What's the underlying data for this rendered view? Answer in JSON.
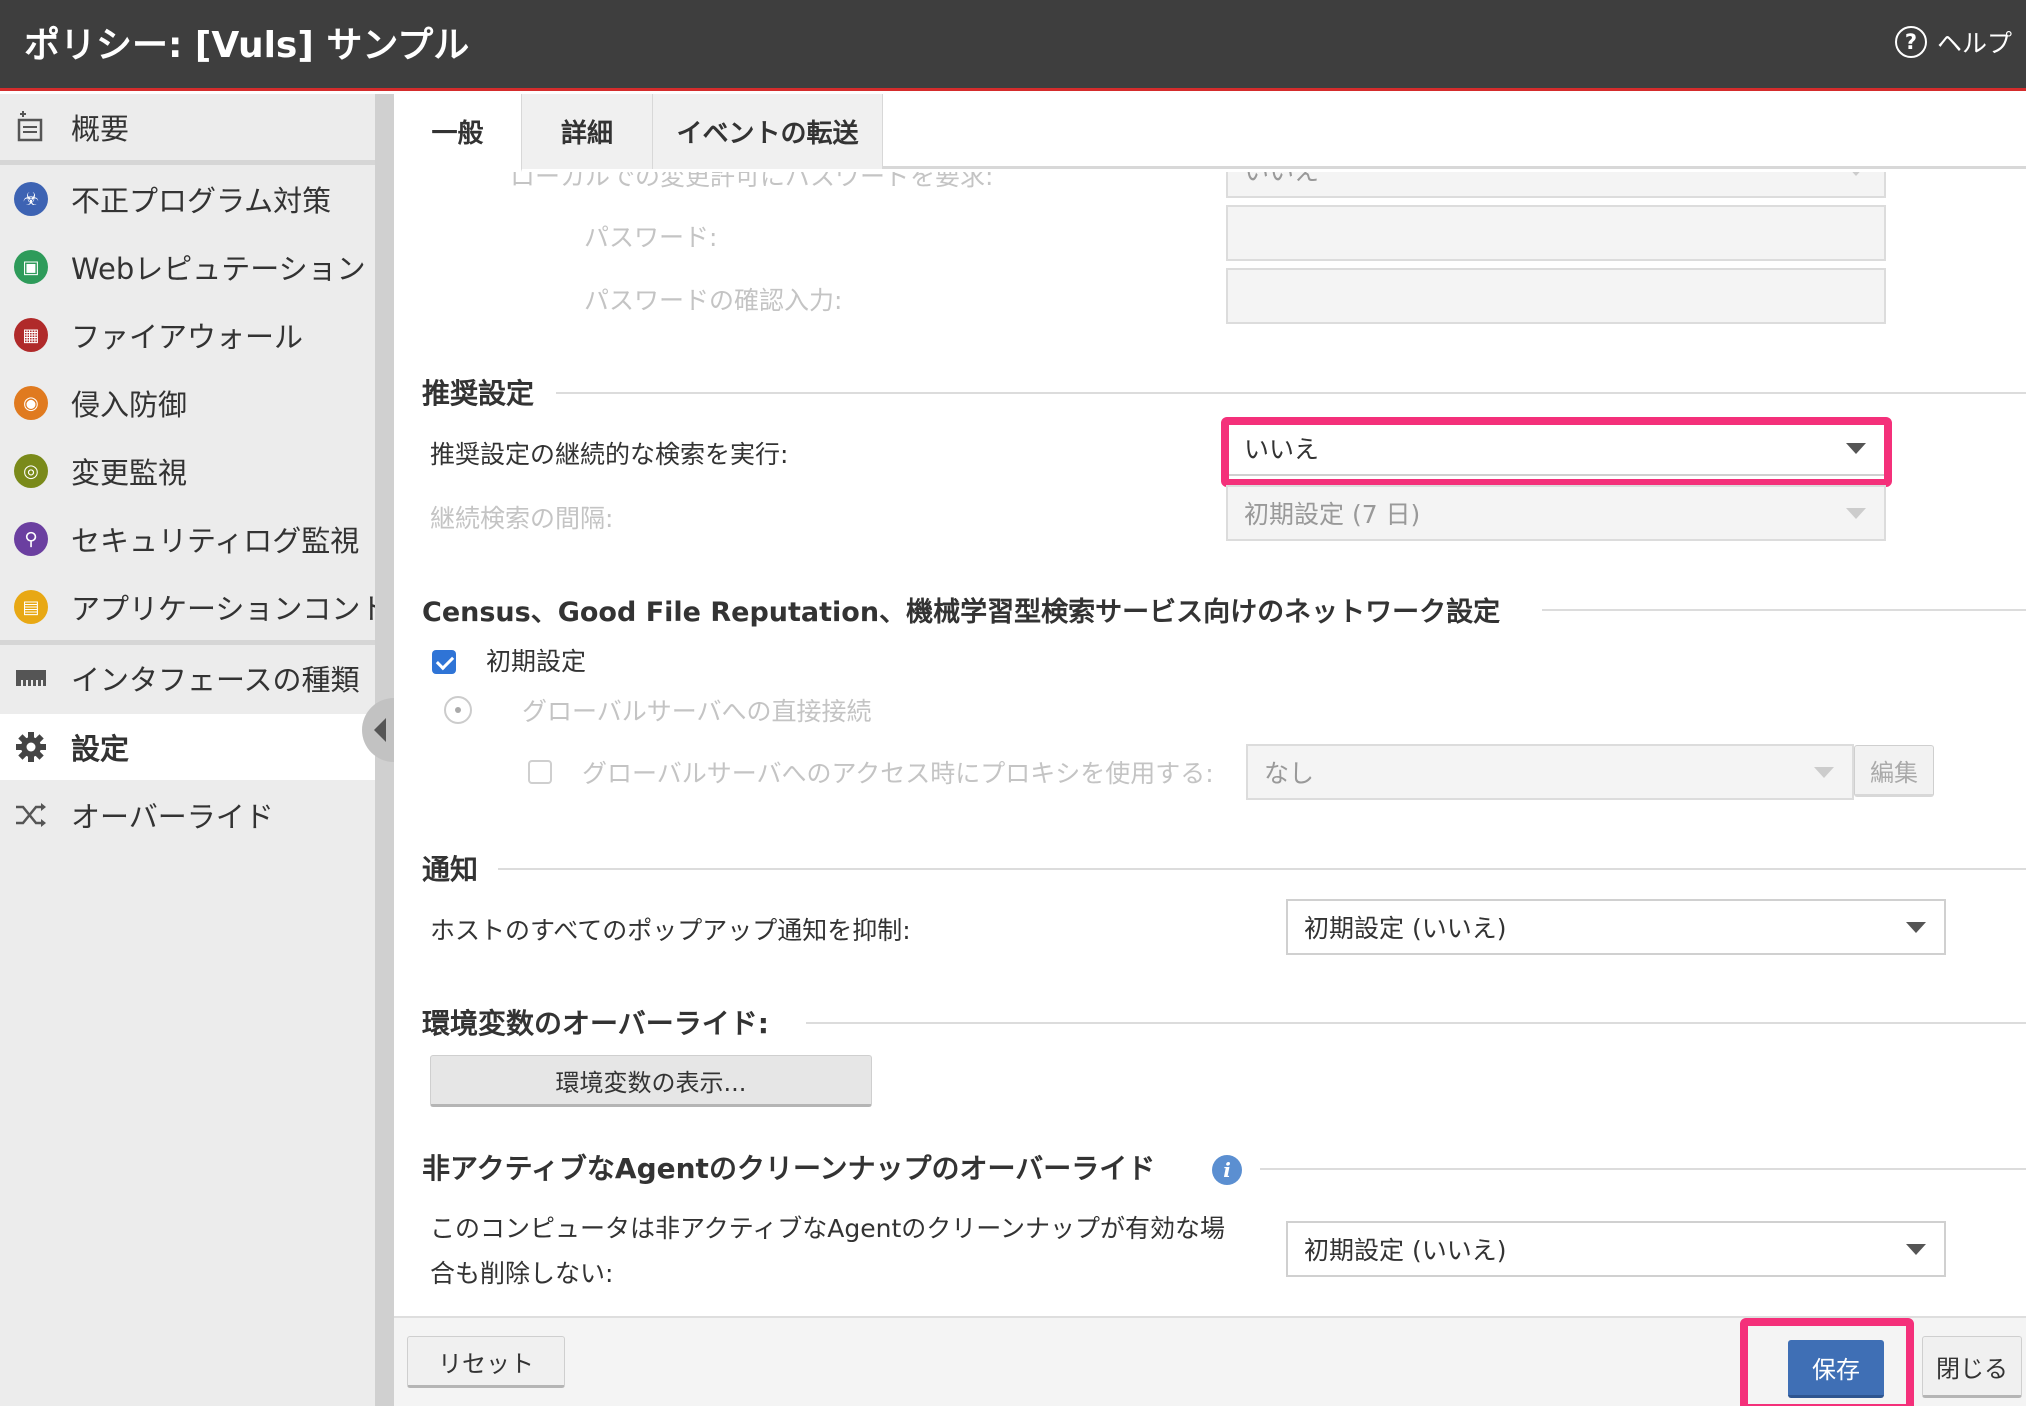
{
  "window": {
    "title": "ポリシー: [Vuls] サンプル",
    "help_label": "ヘルプ",
    "help_icon": "question-circle-icon"
  },
  "sidebar": {
    "items": [
      {
        "label": "概要",
        "icon": "overview-icon"
      },
      {
        "label": "不正プログラム対策",
        "icon": "biohazard-icon"
      },
      {
        "label": "Webレピュテーション",
        "icon": "web-reputation-icon"
      },
      {
        "label": "ファイアウォール",
        "icon": "firewall-icon"
      },
      {
        "label": "侵入防御",
        "icon": "intrusion-prevention-icon"
      },
      {
        "label": "変更監視",
        "icon": "integrity-monitoring-icon"
      },
      {
        "label": "セキュリティログ監視",
        "icon": "log-inspection-icon"
      },
      {
        "label": "アプリケーションコントロール",
        "icon": "application-control-icon"
      },
      {
        "label": "インタフェースの種類",
        "icon": "interface-icon"
      },
      {
        "label": "設定",
        "icon": "gear-icon"
      },
      {
        "label": "オーバーライド",
        "icon": "shuffle-icon"
      }
    ],
    "active": "設定"
  },
  "tabs": [
    "一般",
    "詳細",
    "イベントの転送"
  ],
  "content": {
    "top_partial": {
      "cut_label": "ローカルでの変更許可にパスワードを要求:",
      "cut_value": "いいえ",
      "password_label": "パスワード:",
      "password_confirm_label": "パスワードの確認入力:"
    },
    "recommendation": {
      "heading": "推奨設定",
      "ongoing_scan_label": "推奨設定の継続的な検索を実行:",
      "ongoing_scan_value": "いいえ",
      "interval_label": "継続検索の間隔:",
      "interval_value": "初期設定 (7 日)"
    },
    "network": {
      "heading": "Census、Good File Reputation、機械学習型検索サービス向けのネットワーク設定",
      "default_label": "初期設定",
      "default_checked": true,
      "direct_label": "グローバルサーバへの直接接続",
      "proxy_label": "グローバルサーバへのアクセス時にプロキシを使用する:",
      "proxy_value": "なし",
      "edit_label": "編集"
    },
    "notification": {
      "heading": "通知",
      "suppress_label": "ホストのすべてのポップアップ通知を抑制:",
      "suppress_value": "初期設定 (いいえ)"
    },
    "env": {
      "heading": "環境変数のオーバーライド:",
      "button_label": "環境変数の表示..."
    },
    "cleanup": {
      "heading": "非アクティブなAgentのクリーンナップのオーバーライド",
      "label_line1": "このコンピュータは非アクティブなAgentのクリーンナップが有効な場",
      "label_line2": "合も削除しない:",
      "value": "初期設定 (いいえ)"
    }
  },
  "footer": {
    "reset_label": "リセット",
    "save_label": "保存",
    "close_label": "閉じる"
  },
  "colors": {
    "titlebar": "#3e3e3e",
    "accent_line": "#d42c2c",
    "highlight": "#f4307a",
    "primary_button": "#3f6fb5",
    "checkbox": "#2f74d6"
  }
}
